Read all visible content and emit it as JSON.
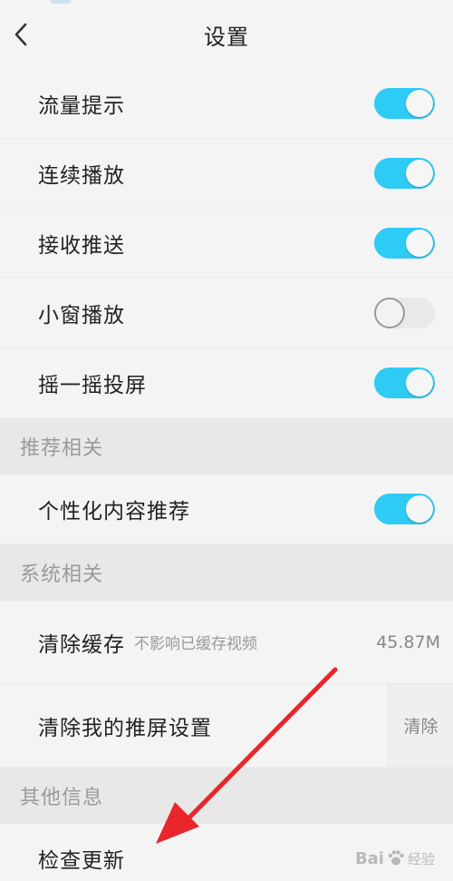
{
  "header": {
    "title": "设置",
    "back_icon": "chevron-left-icon"
  },
  "rows_top": [
    {
      "label": "流量提示",
      "toggle": true
    },
    {
      "label": "连续播放",
      "toggle": true
    },
    {
      "label": "接收推送",
      "toggle": true
    },
    {
      "label": "小窗播放",
      "toggle": false
    },
    {
      "label": "摇一摇投屏",
      "toggle": true
    }
  ],
  "sections": {
    "recommend": "推荐相关",
    "system": "系统相关",
    "other": "其他信息"
  },
  "recommend_row": {
    "label": "个性化内容推荐",
    "toggle": true
  },
  "clear_cache": {
    "label": "清除缓存",
    "sub": "不影响已缓存视频",
    "value": "45.87M"
  },
  "clear_cast": {
    "label": "清除我的推屏设置",
    "action": "清除"
  },
  "check_update": {
    "label": "检查更新"
  },
  "watermark": {
    "brand": "Bai",
    "brand2": "经验"
  },
  "colors": {
    "toggle_on": "#2ecbf5",
    "toggle_off": "#e9e9e9",
    "section_bg": "#e8e8e8",
    "annotation_arrow": "#e8262b"
  }
}
